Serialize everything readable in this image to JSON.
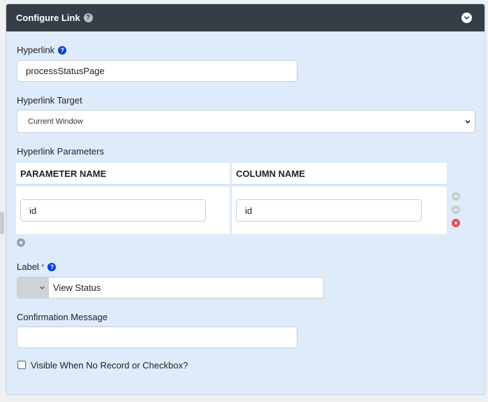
{
  "header": {
    "title": "Configure Link",
    "help_icon": "question-circle-icon",
    "collapse_icon": "chevron-down-circle-icon"
  },
  "hyperlink": {
    "label": "Hyperlink",
    "value": "processStatusPage"
  },
  "hyperlink_target": {
    "label": "Hyperlink Target",
    "selected": "Current Window"
  },
  "hyperlink_parameters": {
    "label": "Hyperlink Parameters",
    "columns": [
      "PARAMETER NAME",
      "COLUMN NAME"
    ],
    "rows": [
      {
        "parameter_name": "id",
        "column_name": "id"
      }
    ]
  },
  "label_field": {
    "label": "Label",
    "required_mark": "*",
    "value": "View Status"
  },
  "confirmation": {
    "label": "Confirmation Message",
    "value": ""
  },
  "visible_checkbox": {
    "label": "Visible When No Record or Checkbox?",
    "checked": false
  },
  "colors": {
    "header_bg": "#353d46",
    "panel_bg": "#ddebfb",
    "help_blue": "#0b3fcf",
    "delete_red": "#e0524f"
  }
}
